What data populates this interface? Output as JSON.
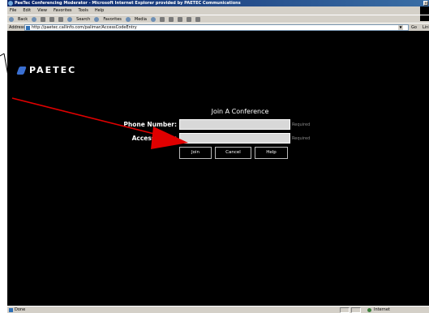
{
  "window": {
    "title": "PaeTec Conferencing Moderator - Microsoft Internet Explorer provided by PAETEC Communications"
  },
  "menu": [
    "File",
    "Edit",
    "View",
    "Favorites",
    "Tools",
    "Help"
  ],
  "toolbar": {
    "back_label": "Back",
    "search_label": "Search",
    "favorites_label": "Favorites",
    "media_label": "Media"
  },
  "address": {
    "label": "Address",
    "url": "http://paetec.callinfo.com/palimar/AccessCodeEntry",
    "go_label": "Go",
    "links_label": "Links"
  },
  "page": {
    "logo_text": "PAETEC",
    "heading": "Join A Conference",
    "phone_label": "Phone Number:",
    "phone_value": "",
    "access_label": "Access Code:",
    "access_value": "",
    "required_text": "Required",
    "buttons": {
      "join": "Join",
      "cancel": "Cancel",
      "help": "Help"
    }
  },
  "status": {
    "text": "Done",
    "zone": "Internet"
  },
  "colors": {
    "page_background": "#000000",
    "annotation_arrow": "#e00000",
    "logo_accent": "#3a6fd1"
  }
}
